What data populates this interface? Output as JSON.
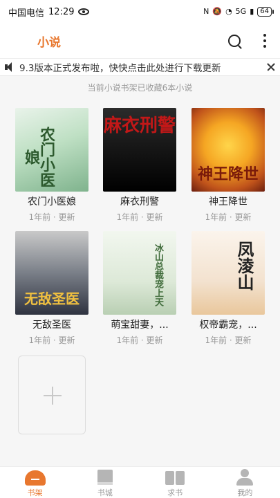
{
  "status_bar": {
    "carrier": "中国电信",
    "time": "12:29",
    "network": "5G",
    "signal": "5G",
    "battery": "64"
  },
  "app_bar": {
    "tab_label": "小说",
    "search_icon": "search-icon",
    "more_icon": "more-vertical-icon"
  },
  "notice": {
    "text": "9.3版本正式发布啦，快快点击此处进行下载更新",
    "icon": "speaker-icon"
  },
  "shelf": {
    "info": "当前小说书架已收藏6本小说",
    "books": [
      {
        "title": "农门小医娘",
        "updated": "1年前 · 更新",
        "cover_text": "农门小医娘"
      },
      {
        "title": "麻衣刑警",
        "updated": "1年前 · 更新",
        "cover_text": "麻衣刑警"
      },
      {
        "title": "神王降世",
        "updated": "1年前 · 更新",
        "cover_text": "神王降世"
      },
      {
        "title": "无敌圣医",
        "updated": "1年前 · 更新",
        "cover_text": "无敌圣医"
      },
      {
        "title": "萌宝甜妻，...",
        "updated": "1年前 · 更新",
        "cover_text": "冰山总裁宠上天"
      },
      {
        "title": "权帝霸宠，...",
        "updated": "1年前 · 更新",
        "cover_text": "凤淩山"
      }
    ]
  },
  "bottom_nav": {
    "items": [
      {
        "label": "书架",
        "active": true
      },
      {
        "label": "书城",
        "active": false
      },
      {
        "label": "求书",
        "active": false
      },
      {
        "label": "我的",
        "active": false
      }
    ]
  },
  "colors": {
    "accent": "#e8772e",
    "muted": "#999999"
  }
}
